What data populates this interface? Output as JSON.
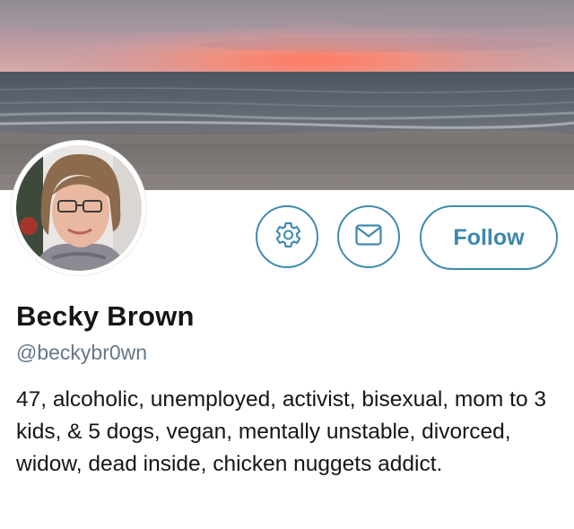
{
  "profile": {
    "display_name": "Becky Brown",
    "handle": "@beckybr0wn",
    "bio": "47, alcoholic, unemployed, activist, bisexual, mom to 3 kids, & 5 dogs, vegan, mentally unstable, divorced, widow, dead inside, chicken nuggets addict."
  },
  "actions": {
    "settings_icon": "gear-icon",
    "message_icon": "envelope-icon",
    "follow_label": "Follow"
  },
  "colors": {
    "accent": "#3f8ab0",
    "name_text": "#14171a",
    "handle_text": "#657786"
  }
}
